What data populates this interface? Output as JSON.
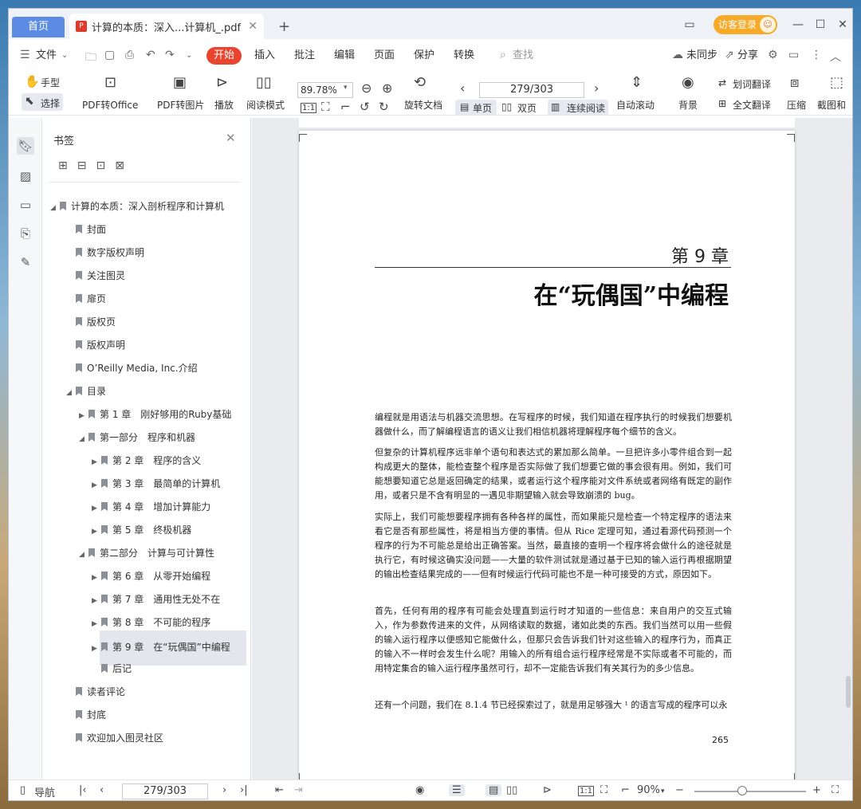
{
  "tabs": {
    "home": "首页",
    "doc": "计算的本质：深入...计算机_.pdf",
    "add": "+"
  },
  "header": {
    "visitor": "访客登录"
  },
  "menu": {
    "file": "文件",
    "start": "开始",
    "items": [
      "插入",
      "批注",
      "编辑",
      "页面",
      "保护",
      "转换"
    ],
    "search": "查找",
    "sync": "未同步",
    "share": "分享"
  },
  "toolbar": {
    "hand": "手型",
    "select": "选择",
    "pdf_office": "PDF转Office",
    "pdf_image": "PDF转图片",
    "play": "播放",
    "read_mode": "阅读模式",
    "zoom": "89.78%",
    "page": "279/303",
    "rotate": "旋转文档",
    "single": "单页",
    "double": "双页",
    "continuous": "连续阅读",
    "auto_scroll": "自动滚动",
    "background": "背景",
    "word_translate": "划词翻译",
    "full_translate": "全文翻译",
    "compress": "压缩",
    "screenshot": "截图和"
  },
  "sidebar": {
    "title": "书签"
  },
  "bookmarks": [
    {
      "label": "计算的本质：深入剖析程序和计算机",
      "level": 0,
      "arrow": "◢"
    },
    {
      "label": "封面",
      "level": 1,
      "arrow": ""
    },
    {
      "label": "数字版权声明",
      "level": 1,
      "arrow": ""
    },
    {
      "label": "关注图灵",
      "level": 1,
      "arrow": ""
    },
    {
      "label": "扉页",
      "level": 1,
      "arrow": ""
    },
    {
      "label": "版权页",
      "level": 1,
      "arrow": ""
    },
    {
      "label": "版权声明",
      "level": 1,
      "arrow": ""
    },
    {
      "label": "O’Reilly Media, Inc.介绍",
      "level": 1,
      "arrow": ""
    },
    {
      "label": "目录",
      "level": 1,
      "arrow": "◢"
    },
    {
      "label": "第 1 章　刚好够用的Ruby基础",
      "level": 2,
      "arrow": "▶"
    },
    {
      "label": "第一部分　程序和机器",
      "level": 2,
      "arrow": "◢"
    },
    {
      "label": "第 2 章　程序的含义",
      "level": 3,
      "arrow": "▶"
    },
    {
      "label": "第 3 章　最简单的计算机",
      "level": 3,
      "arrow": "▶"
    },
    {
      "label": "第 4 章　增加计算能力",
      "level": 3,
      "arrow": "▶"
    },
    {
      "label": "第 5 章　终极机器",
      "level": 3,
      "arrow": "▶"
    },
    {
      "label": "第二部分　计算与可计算性",
      "level": 2,
      "arrow": "◢"
    },
    {
      "label": "第 6 章　从零开始编程",
      "level": 3,
      "arrow": "▶"
    },
    {
      "label": "第 7 章　通用性无处不在",
      "level": 3,
      "arrow": "▶"
    },
    {
      "label": "第 8 章　不可能的程序",
      "level": 3,
      "arrow": "▶"
    },
    {
      "label": "第 9 章　在“玩偶国”中编程",
      "level": 3,
      "arrow": "▶"
    },
    {
      "label": "后记",
      "level": 3,
      "arrow": ""
    },
    {
      "label": "读者评论",
      "level": 1,
      "arrow": ""
    },
    {
      "label": "封底",
      "level": 1,
      "arrow": ""
    },
    {
      "label": "欢迎加入图灵社区",
      "level": 1,
      "arrow": ""
    }
  ],
  "page": {
    "chapter": "第 9 章",
    "title": "在“玩偶国”中编程",
    "paragraphs": [
      "编程就是用语法与机器交流思想。在写程序的时候，我们知道在程序执行的时候我们想要机器做什么，而了解编程语言的语义让我们相信机器将理解程序每个细节的含义。",
      "但复杂的计算机程序远非单个语句和表达式的累加那么简单。一旦把许多小零件组合到一起构成更大的整体，能检查整个程序是否实际做了我们想要它做的事会很有用。例如，我们可能想要知道它总是返回确定的结果，或者运行这个程序能对文件系统或者网络有既定的副作用，或者只是不含有明显的一遇见非期望输入就会导致崩溃的 bug。",
      "实际上，我们可能想要程序拥有各种各样的属性，而如果能只是检查一个特定程序的语法来看它是否有那些属性，将是相当方便的事情。但从 Rice 定理可知，通过看源代码预测一个程序的行为不可能总是给出正确答案。当然，最直接的查明一个程序将会做什么的途径就是执行它，有时候这确实没问题——大量的软件测试就是通过基于已知的输入运行再根据期望的输出检查结果完成的——但有时候运行代码可能也不是一种可接受的方式，原因如下。",
      "首先，任何有用的程序有可能会处理直到运行时才知道的一些信息：来自用户的交互式输入，作为参数传进来的文件，从网络读取的数据，诸如此类的东西。我们当然可以用一些假的输入运行程序以便感知它能做什么，但那只会告诉我们针对这些输入的程序行为，而真正的输入不一样时会发生什么呢？用输入的所有组合运行程序经常是不实际或者不可能的，而用特定集合的输入运行程序虽然可行，却不一定能告诉我们有关其行为的多少信息。",
      "还有一个问题，我们在 8.1.4 节已经探索过了，就是用足够强大 ¹ 的语言写成的程序可以永"
    ],
    "number": "265"
  },
  "status": {
    "nav": "导航",
    "page": "279/303",
    "zoom": "90%"
  }
}
